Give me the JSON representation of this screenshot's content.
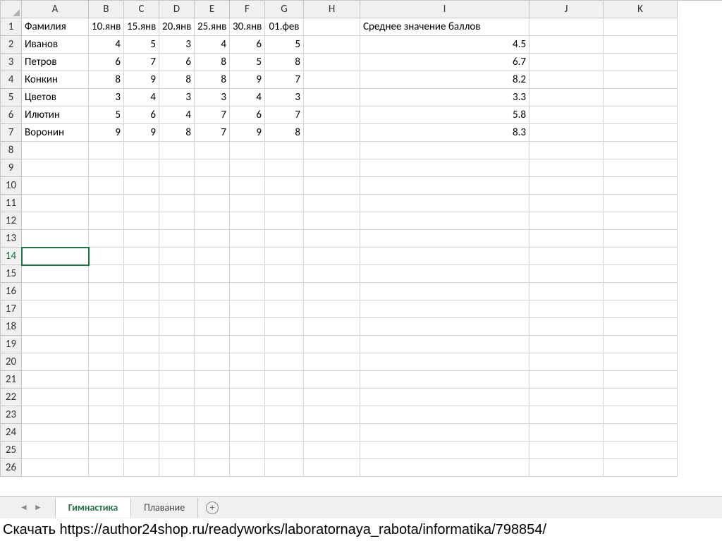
{
  "columns": [
    "A",
    "B",
    "C",
    "D",
    "E",
    "F",
    "G",
    "H",
    "I",
    "J",
    "K"
  ],
  "row_count": 26,
  "selected_row": 14,
  "headers_row": [
    "Фамилия",
    "10.янв",
    "15.янв",
    "20.янв",
    "25.янв",
    "30.янв",
    "01.фев",
    "",
    "Среднее значение баллов",
    "",
    ""
  ],
  "data_rows": [
    {
      "name": "Иванов",
      "v": [
        4,
        5,
        3,
        4,
        6,
        5
      ],
      "avg": "4.5"
    },
    {
      "name": "Петров",
      "v": [
        6,
        7,
        6,
        8,
        5,
        8
      ],
      "avg": "6.7"
    },
    {
      "name": "Конкин",
      "v": [
        8,
        9,
        8,
        8,
        9,
        7
      ],
      "avg": "8.2"
    },
    {
      "name": "Цветов",
      "v": [
        3,
        4,
        3,
        3,
        4,
        3
      ],
      "avg": "3.3"
    },
    {
      "name": "Илютин",
      "v": [
        5,
        6,
        4,
        7,
        6,
        7
      ],
      "avg": "5.8"
    },
    {
      "name": "Воронин",
      "v": [
        9,
        9,
        8,
        7,
        9,
        8
      ],
      "avg": "8.3"
    }
  ],
  "tabs": {
    "active": "Гимнастика",
    "others": [
      "Плавание"
    ]
  },
  "footer_text": "Скачать https://author24shop.ru/readyworks/laboratornaya_rabota/informatika/798854/"
}
